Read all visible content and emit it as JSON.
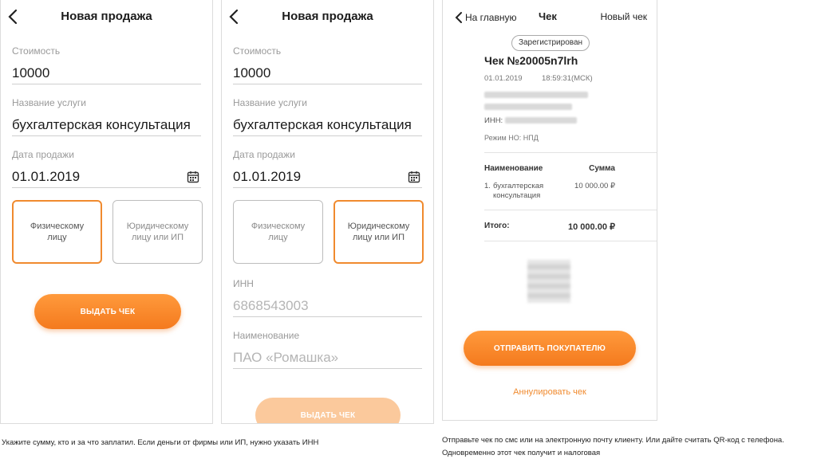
{
  "screen1": {
    "title": "Новая продажа",
    "cost_label": "Стоимость",
    "cost_value": "10000",
    "service_label": "Название услуги",
    "service_value": "бухгалтерская консультация",
    "date_label": "Дата продажи",
    "date_value": "01.01.2019",
    "card_individual": "Физическому\nлицу",
    "card_company": "Юридическому\nлицу или ИП",
    "selected_card": "individual",
    "button": "ВЫДАТЬ ЧЕК"
  },
  "screen2": {
    "title": "Новая продажа",
    "cost_label": "Стоимость",
    "cost_value": "10000",
    "service_label": "Название услуги",
    "service_value": "бухгалтерская консультация",
    "date_label": "Дата продажи",
    "date_value": "01.01.2019",
    "card_individual": "Физическому\nлицу",
    "card_company": "Юридическому\nлицу или ИП",
    "selected_card": "company",
    "inn_label": "ИНН",
    "inn_placeholder": "6868543003",
    "name_label": "Наименование",
    "name_placeholder": "ПАО «Ромашка»",
    "button": "ВЫДАТЬ ЧЕК"
  },
  "screen3": {
    "back_label": "На главную",
    "title": "Чек",
    "new_check": "Новый чек",
    "status_badge": "Зарегистрирован",
    "receipt_title": "Чек №20005n7lrh",
    "date": "01.01.2019",
    "time": "18:59:31(МСК)",
    "inn_prefix": "ИНН:",
    "tax_mode": "Режим НО: НПД",
    "col_name": "Наименование",
    "col_sum": "Сумма",
    "item_index": "1.",
    "item_name": "бухгалтерская консультация",
    "item_sum": "10 000.00 ₽",
    "total_label": "Итого:",
    "total_value": "10 000.00 ₽",
    "send_button": "ОТПРАВИТЬ ПОКУПАТЕЛЮ",
    "cancel_link": "Аннулировать чек"
  },
  "captions": {
    "left": "Укажите сумму, кто и за что заплатил. Если деньги от фирмы или ИП, нужно указать ИНН",
    "right_line1": "Отправьте чек по смс или на электронную почту клиенту. Или дайте считать QR-код с телефона.",
    "right_line2": "Одновременно этот чек получит и налоговая"
  },
  "colors": {
    "accent": "#f08a2e"
  }
}
